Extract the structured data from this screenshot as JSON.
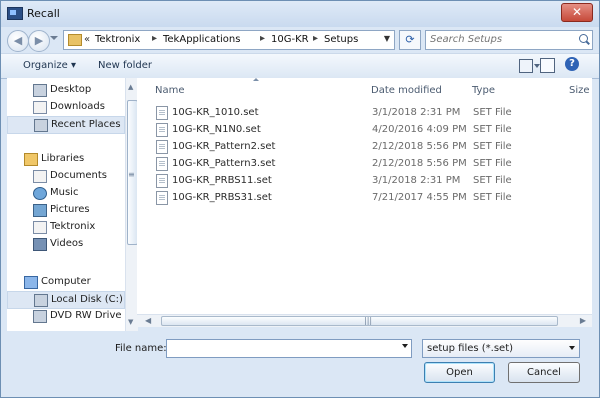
{
  "window": {
    "title": "Recall",
    "close_label": "✕"
  },
  "address": {
    "prefix": "«",
    "crumbs": [
      "Tektronix",
      "TekApplications",
      "10G-KR",
      "Setups"
    ],
    "separator": "▸"
  },
  "search": {
    "placeholder": "Search Setups"
  },
  "toolbar": {
    "organize_label": "Organize ▾",
    "new_folder_label": "New folder"
  },
  "sidebar": {
    "items": [
      {
        "label": "Desktop"
      },
      {
        "label": "Downloads"
      },
      {
        "label": "Recent Places"
      },
      {
        "label": "Libraries"
      },
      {
        "label": "Documents"
      },
      {
        "label": "Music"
      },
      {
        "label": "Pictures"
      },
      {
        "label": "Tektronix"
      },
      {
        "label": "Videos"
      },
      {
        "label": "Computer"
      },
      {
        "label": "Local Disk (C:)"
      },
      {
        "label": "DVD RW Drive (D"
      }
    ]
  },
  "file_list": {
    "columns": [
      "Name",
      "Date modified",
      "Type",
      "Size"
    ],
    "rows": [
      {
        "name": "10G-KR_1010.set",
        "date": "3/1/2018 2:31 PM",
        "type": "SET File"
      },
      {
        "name": "10G-KR_N1N0.set",
        "date": "4/20/2016 4:09 PM",
        "type": "SET File"
      },
      {
        "name": "10G-KR_Pattern2.set",
        "date": "2/12/2018 5:56 PM",
        "type": "SET File"
      },
      {
        "name": "10G-KR_Pattern3.set",
        "date": "2/12/2018 5:56 PM",
        "type": "SET File"
      },
      {
        "name": "10G-KR_PRBS11.set",
        "date": "3/1/2018 2:31 PM",
        "type": "SET File"
      },
      {
        "name": "10G-KR_PRBS31.set",
        "date": "7/21/2017 4:55 PM",
        "type": "SET File"
      }
    ]
  },
  "footer": {
    "filename_label": "File name:",
    "filename_value": "",
    "filetype_value": "setup files (*.set)",
    "open_label": "Open",
    "cancel_label": "Cancel"
  }
}
